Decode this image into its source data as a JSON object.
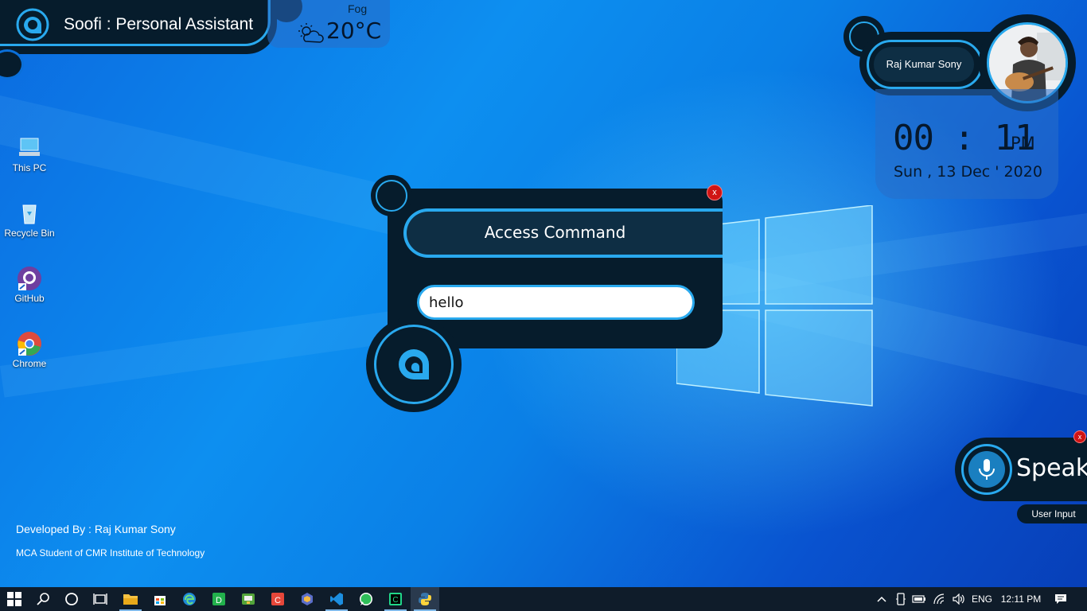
{
  "app": {
    "title": "Soofi : Personal Assistant"
  },
  "weather": {
    "condition": "Fog",
    "temperature": "20°C",
    "icon": "partly-cloudy-icon"
  },
  "profile": {
    "name": "Raj Kumar Sony",
    "avatar_icon": "user-photo"
  },
  "clock": {
    "time": "00 : 11",
    "ampm": "PM",
    "date": "Sun , 13  Dec ' 2020"
  },
  "command_dialog": {
    "title": "Access Command",
    "input_value": "hello",
    "close_label": "x"
  },
  "speak": {
    "label": "Speak",
    "close_label": "x",
    "user_input_label": "User Input"
  },
  "credits": {
    "developed_by": "Developed By :  Raj Kumar Sony",
    "student_line": "MCA Student of CMR Institute of Technology"
  },
  "desktop_icons": [
    {
      "label": "This PC",
      "icon": "computer-icon"
    },
    {
      "label": "Recycle Bin",
      "icon": "recycle-bin-icon"
    },
    {
      "label": "GitHub",
      "icon": "github-icon"
    },
    {
      "label": "Chrome",
      "icon": "chrome-icon"
    }
  ],
  "taskbar": {
    "apps": [
      "start",
      "search",
      "cortana",
      "task-view",
      "file-explorer",
      "store",
      "edge",
      "app-d",
      "app-green",
      "app-c-red",
      "app-hex",
      "vscode",
      "whatsapp",
      "app-c-green",
      "python"
    ],
    "language": "ENG",
    "time": "12:11 PM"
  },
  "colors": {
    "panel_dark": "#061c2c",
    "accent_blue": "#29a9ee",
    "close_red": "#d01414"
  }
}
